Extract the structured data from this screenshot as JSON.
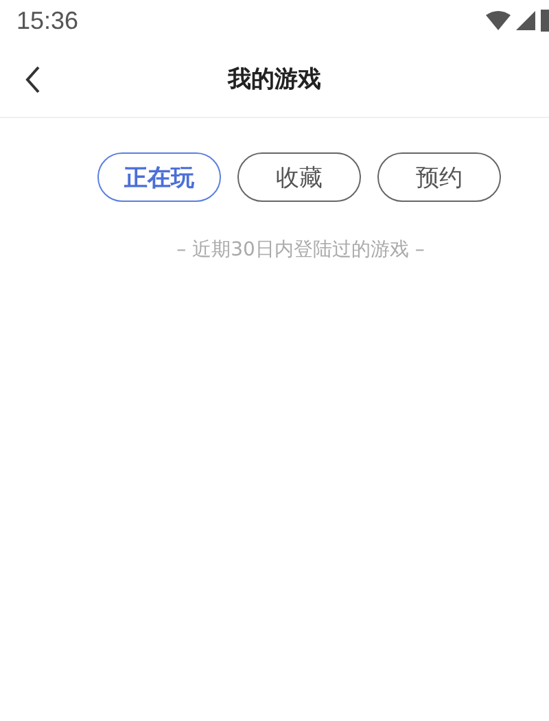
{
  "status_bar": {
    "time": "15:36"
  },
  "header": {
    "title": "我的游戏"
  },
  "tabs": [
    {
      "label": "正在玩",
      "selected": true
    },
    {
      "label": "收藏",
      "selected": false
    },
    {
      "label": "预约",
      "selected": false
    }
  ],
  "note": "– 近期30日内登陆过的游戏 –"
}
